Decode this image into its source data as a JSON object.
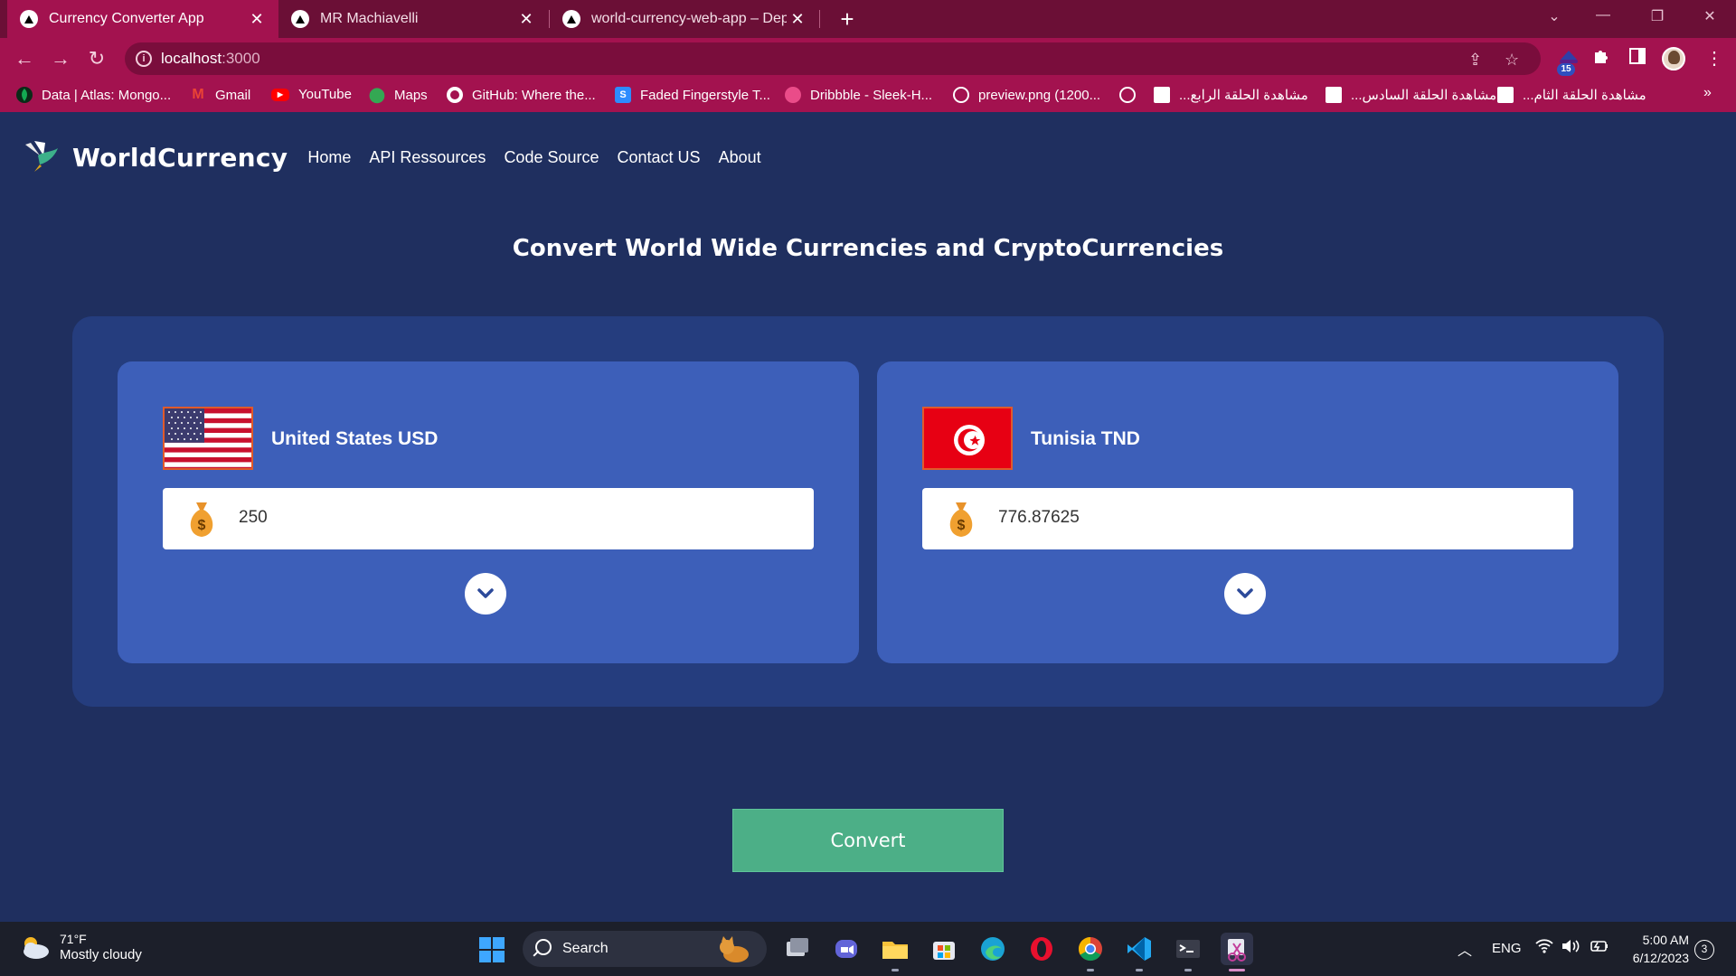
{
  "browser": {
    "tabs": [
      {
        "title": "Currency Converter App",
        "active": true,
        "icon": "vercel-icon"
      },
      {
        "title": "MR Machiavelli",
        "active": false,
        "icon": "vercel-icon"
      },
      {
        "title": "world-currency-web-app – Deplo",
        "active": false,
        "icon": "vercel-icon"
      }
    ],
    "url_host": "localhost",
    "url_port": ":3000",
    "extension_badge": "15",
    "bookmarks": [
      {
        "label": "Data | Atlas: Mongo...",
        "icon": "mongodb-icon",
        "color": "#13aa52"
      },
      {
        "label": "Gmail",
        "icon": "gmail-icon",
        "color": "#ea4335"
      },
      {
        "label": "YouTube",
        "icon": "youtube-icon",
        "color": "#ff0000"
      },
      {
        "label": "Maps",
        "icon": "maps-icon",
        "color": "#34a853"
      },
      {
        "label": "GitHub: Where the...",
        "icon": "github-icon",
        "color": "#ffffff"
      },
      {
        "label": "Faded Fingerstyle T...",
        "icon": "songsterr-icon",
        "color": "#2d8cff"
      },
      {
        "label": "Dribbble - Sleek-H...",
        "icon": "dribbble-icon",
        "color": "#ea4c89"
      },
      {
        "label": "preview.png (1200...",
        "icon": "globe-icon",
        "color": "#ffffff"
      },
      {
        "label": "",
        "icon": "globe-icon",
        "color": "#ffffff"
      },
      {
        "label": "...مشاهدة الحلقة الرابع",
        "icon": "site-icon",
        "color": "#ffffff"
      },
      {
        "label": "...مشاهدة الحلقة السادس",
        "icon": "site-icon",
        "color": "#ffffff"
      },
      {
        "label": "...مشاهدة الحلقة الثام",
        "icon": "site-icon",
        "color": "#ffffff"
      }
    ],
    "bookmarks_overflow": "»"
  },
  "site": {
    "brand": "WorldCurrency",
    "nav": [
      "Home",
      "API Ressources",
      "Code Source",
      "Contact US",
      "About"
    ],
    "headline": "Convert World Wide Currencies and CryptoCurrencies",
    "from": {
      "country_label": "United States USD",
      "amount": "250",
      "flag": "us-flag"
    },
    "to": {
      "country_label": "Tunisia TND",
      "amount": "776.87625",
      "flag": "tunisia-flag"
    },
    "convert_label": "Convert"
  },
  "taskbar": {
    "weather_temp": "71°F",
    "weather_condition": "Mostly cloudy",
    "search_label": "Search",
    "language": "ENG",
    "time": "5:00 AM",
    "date": "6/12/2023",
    "notification_count": "3"
  },
  "colors": {
    "tabbar": "#6b0f36",
    "chrome_accent": "#a3124f",
    "page_bg": "#1f2f5f",
    "panel_bg": "#253d7e",
    "card_bg": "#3d5fb9",
    "convert_button": "#4caf87"
  }
}
